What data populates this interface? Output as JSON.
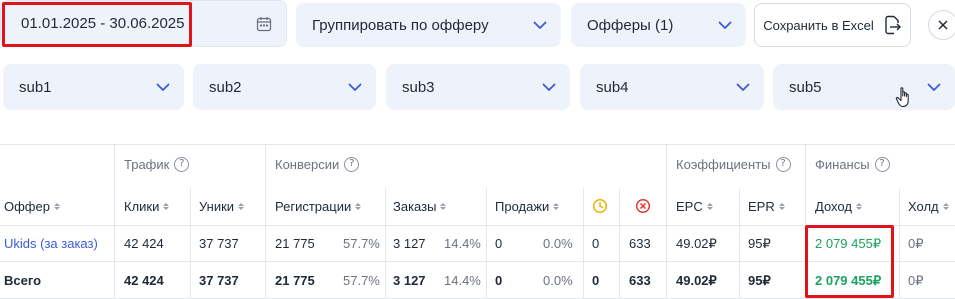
{
  "filters": {
    "date_range": "01.01.2025 - 30.06.2025",
    "group_by": "Группировать по офферу",
    "offers": "Офферы (1)",
    "export_label": "Сохранить в Excel",
    "subs": [
      "sub1",
      "sub2",
      "sub3",
      "sub4",
      "sub5"
    ]
  },
  "table": {
    "groups": {
      "traffic": "Трафик",
      "conversions": "Конверсии",
      "coefficients": "Коэффициенты",
      "finance": "Финансы"
    },
    "columns": {
      "offer": "Оффер",
      "clicks": "Клики",
      "uniques": "Уники",
      "registrations": "Регистрации",
      "orders": "Заказы",
      "sales": "Продажи",
      "epc": "EPC",
      "epr": "EPR",
      "income": "Доход",
      "hold": "Холд"
    },
    "rows": [
      {
        "offer": "Ukids (за заказ)",
        "clicks": "42 424",
        "uniques": "37 737",
        "registrations": "21 775",
        "registrations_pct": "57.7%",
        "orders": "3 127",
        "orders_pct": "14.4%",
        "sales": "0",
        "sales_pct": "0.0%",
        "pending": "0",
        "rejected": "633",
        "epc": "49.02₽",
        "epr": "95₽",
        "income": "2 079 455₽",
        "hold": "0₽"
      },
      {
        "offer": "Всего",
        "clicks": "42 424",
        "uniques": "37 737",
        "registrations": "21 775",
        "registrations_pct": "57.7%",
        "orders": "3 127",
        "orders_pct": "14.4%",
        "sales": "0",
        "sales_pct": "0.0%",
        "pending": "0",
        "rejected": "633",
        "epc": "49.02₽",
        "epr": "95₽",
        "income": "2 079 455₽",
        "hold": "0₽"
      }
    ]
  },
  "colors": {
    "accent_red": "#e0131b",
    "income_green": "#1aa260",
    "link_blue": "#3b5bd6",
    "field_bg": "#eef2fb",
    "pending_yellow": "#e7b400",
    "rejected_red": "#e53935"
  },
  "icons": {
    "calendar": "calendar-icon",
    "export": "file-export-icon",
    "close": "close-icon",
    "pending": "clock-icon",
    "rejected": "x-circle-icon",
    "dropdown": "chevron-down-icon",
    "info": "info-icon",
    "sort": "sort-icon"
  }
}
